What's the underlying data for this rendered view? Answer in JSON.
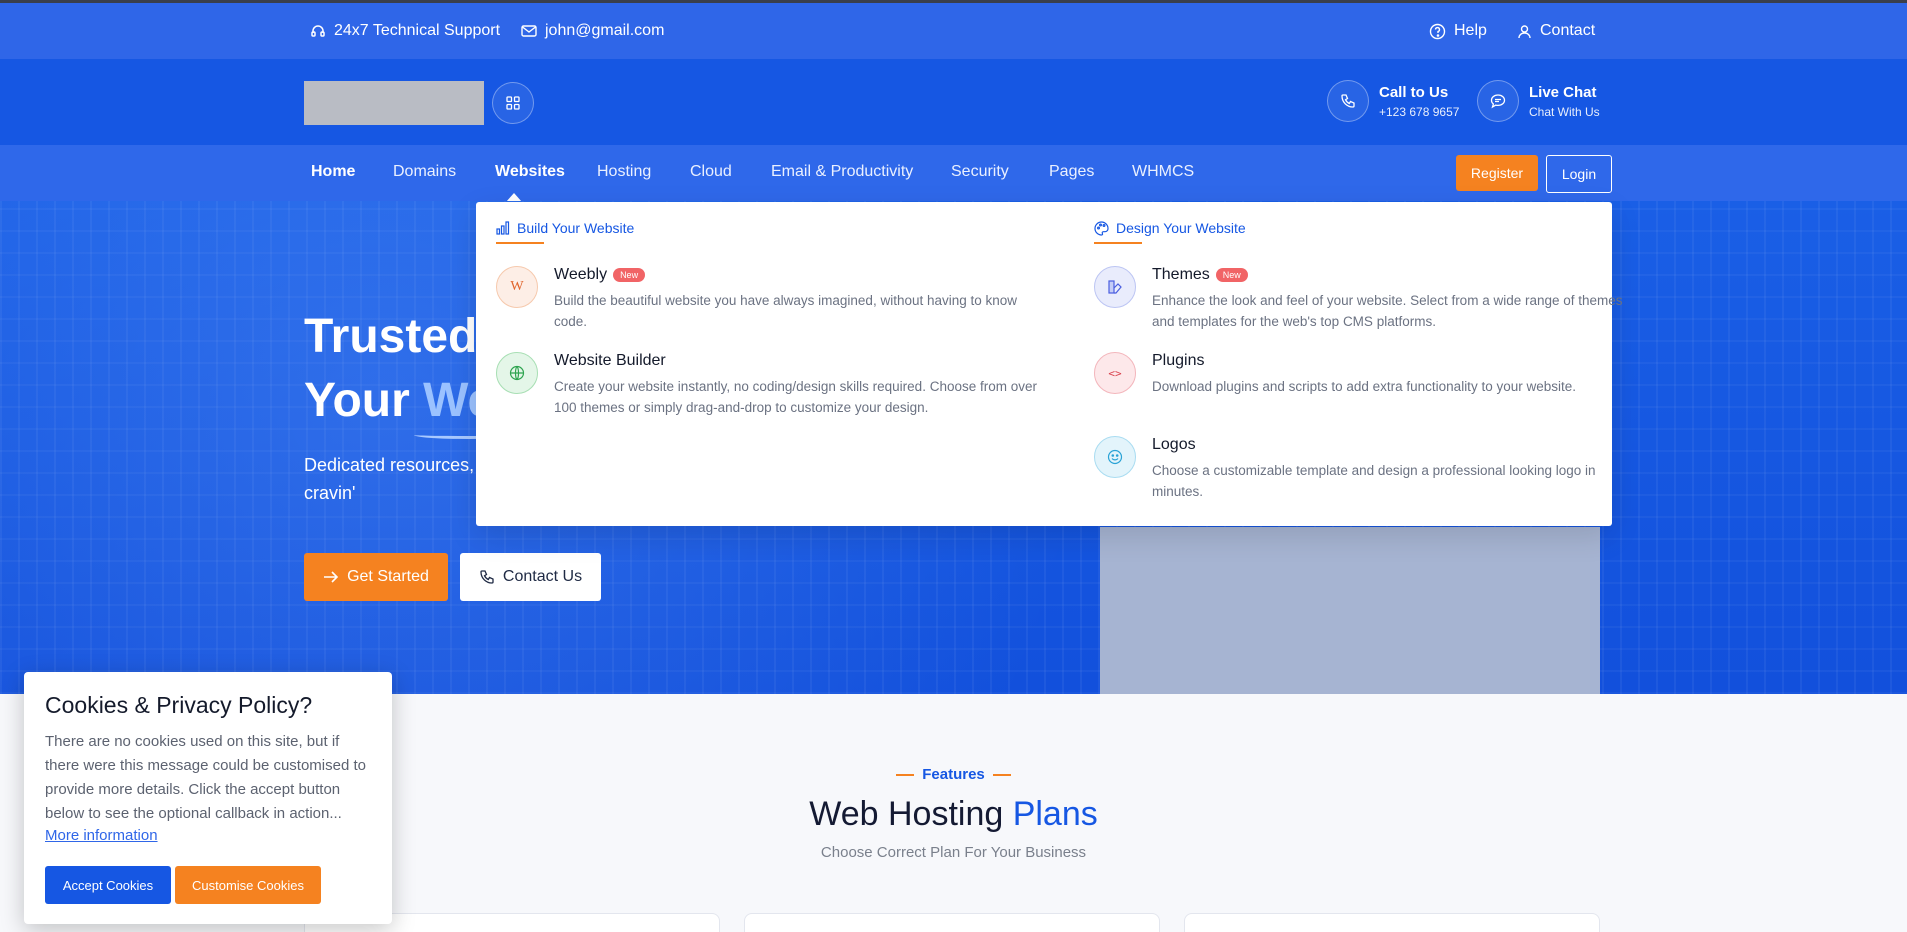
{
  "topbar": {
    "support_label": "24x7 Technical Support",
    "email": "john@gmail.com",
    "help_label": "Help",
    "contact_label": "Contact"
  },
  "header": {
    "call_title": "Call to Us",
    "call_number": "+123 678 9657",
    "chat_title": "Live Chat",
    "chat_sub": "Chat With Us"
  },
  "nav": {
    "items": [
      "Home",
      "Domains",
      "Websites",
      "Hosting",
      "Cloud",
      "Email & Productivity",
      "Security",
      "Pages",
      "WHMCS"
    ],
    "register_label": "Register",
    "login_label": "Login"
  },
  "hero": {
    "title_line1": "Trusted",
    "title_line2_a": "Your ",
    "title_line2_b": "We",
    "subtitle": "Dedicated resources,\ncravin'",
    "get_started_label": "Get Started",
    "contact_us_label": "Contact Us"
  },
  "dropdown": {
    "col1_title": "Build Your Website",
    "col2_title": "Design Your Website",
    "col1_items": [
      {
        "title": "Weebly",
        "badge": "New",
        "icon_letter": "W",
        "desc": "Build the beautiful website you have always imagined, without having to know code."
      },
      {
        "title": "Website Builder",
        "badge": "",
        "desc": "Create your website instantly, no coding/design skills required. Choose from over 100 themes or simply drag-and-drop to customize your design."
      }
    ],
    "col2_items": [
      {
        "title": "Themes",
        "badge": "New",
        "desc": "Enhance the look and feel of your website. Select from a wide range of themes and templates for the web's top CMS platforms."
      },
      {
        "title": "Plugins",
        "badge": "",
        "icon_glyph": "<>",
        "desc": "Download plugins and scripts to add extra functionality to your website."
      },
      {
        "title": "Logos",
        "badge": "",
        "desc": "Choose a customizable template and design a professional looking logo in minutes."
      }
    ]
  },
  "features": {
    "kicker": "Features",
    "title_a": "Web Hosting ",
    "title_b": "Plans",
    "subtitle": "Choose Correct Plan For Your Business"
  },
  "cookie": {
    "title": "Cookies & Privacy Policy?",
    "text": "There are no cookies used on this site, but if there were this message could be customised to provide more details. Click the accept button below to see the optional callback in action...",
    "link": "More information",
    "accept_label": "Accept Cookies",
    "customise_label": "Customise Cookies"
  },
  "colors": {
    "primary": "#1657e3",
    "topbar": "#2f66e8",
    "accent": "#f58220",
    "badge": "#f16466"
  }
}
